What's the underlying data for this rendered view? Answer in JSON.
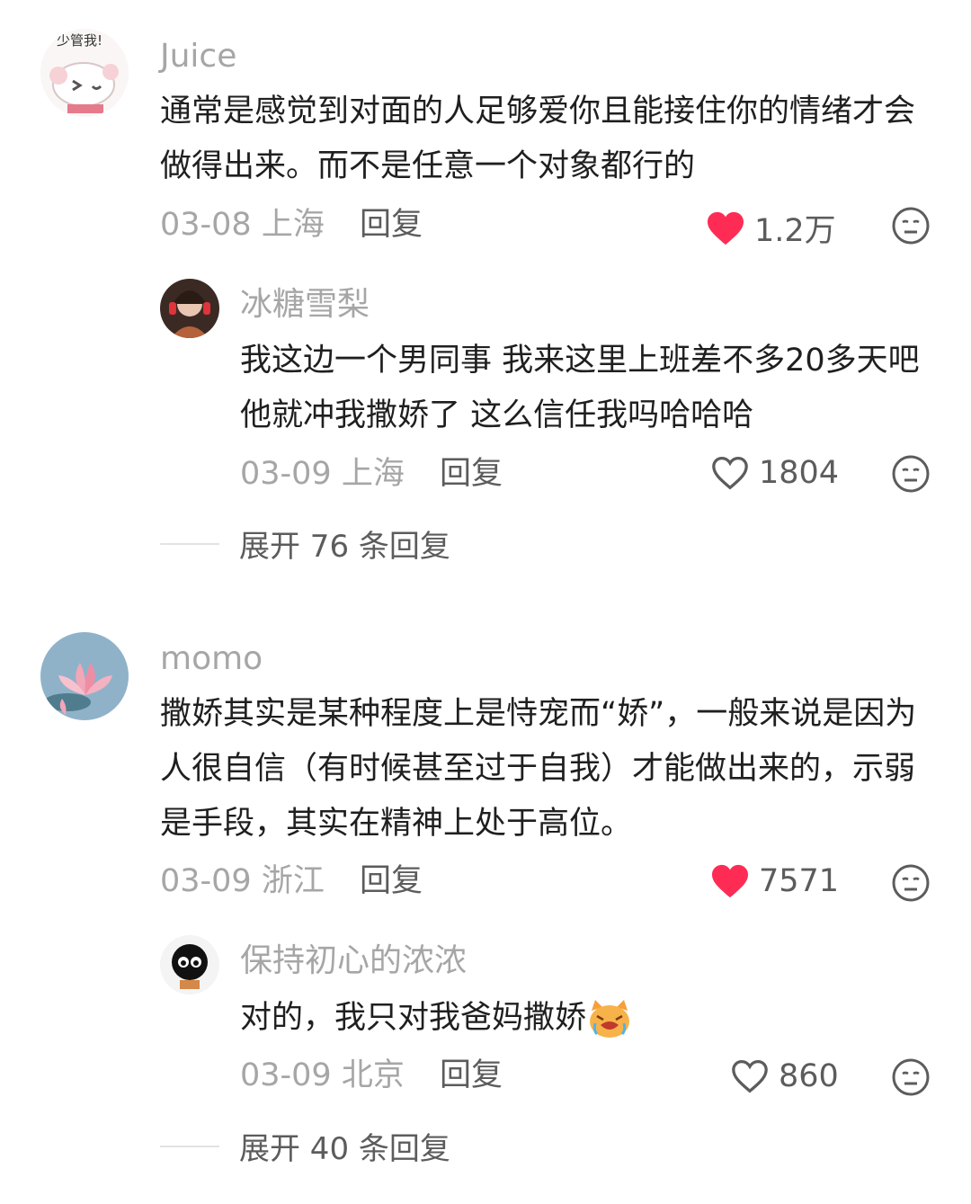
{
  "comments": [
    {
      "user": "Juice",
      "avatar_text": "少管我!",
      "text": "通常是感觉到对面的人足够爱你且能接住你的情绪才会做得出来。而不是任意一个对象都行的",
      "date": "03-08",
      "location": "上海",
      "reply_label": "回复",
      "likes": "1.2万",
      "liked": true,
      "replies": [
        {
          "user": "冰糖雪梨",
          "text": "我这边一个男同事 我来这里上班差不多20多天吧 他就冲我撒娇了 这么信任我吗哈哈哈",
          "date": "03-09",
          "location": "上海",
          "reply_label": "回复",
          "likes": "1804",
          "liked": false
        }
      ],
      "expand_label": "展开 76 条回复"
    },
    {
      "user": "momo",
      "text": "撒娇其实是某种程度上是恃宠而“娇”，一般来说是因为人很自信（有时候甚至过于自我）才能做出来的，示弱是手段，其实在精神上处于高位。",
      "date": "03-09",
      "location": "浙江",
      "reply_label": "回复",
      "likes": "7571",
      "liked": true,
      "replies": [
        {
          "user": "保持初心的浓浓",
          "text": "对的，我只对我爸妈撒娇",
          "text_emoji": "crying-cat-emoji",
          "date": "03-09",
          "location": "北京",
          "reply_label": "回复",
          "likes": "860",
          "liked": false
        }
      ],
      "expand_label": "展开 40 条回复"
    }
  ],
  "colors": {
    "heart_liked": "#fe2c55",
    "muted_text": "#a6a6a6",
    "action_text": "#5c5c5c",
    "body_text": "#1f1f1f"
  },
  "icons": {
    "like_filled": "heart-filled-icon",
    "like_outline": "heart-outline-icon",
    "reaction": "neutral-face-icon"
  }
}
